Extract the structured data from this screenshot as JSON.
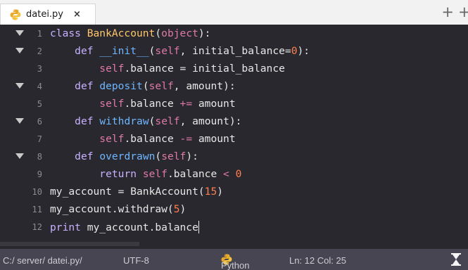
{
  "tab": {
    "filename": "datei.py",
    "close_label": "×"
  },
  "toolbar": {
    "add_icon": "+",
    "menu_icon": "+"
  },
  "editor": {
    "lines": [
      {
        "num": "1",
        "fold": true,
        "tokens": [
          [
            "k",
            "class "
          ],
          [
            "c",
            "BankAccount"
          ],
          [
            "o",
            "("
          ],
          [
            "s",
            "object"
          ],
          [
            "o",
            "):"
          ]
        ]
      },
      {
        "num": "2",
        "fold": true,
        "tokens": [
          [
            "o",
            "    "
          ],
          [
            "k",
            "def "
          ],
          [
            "f",
            "__init__"
          ],
          [
            "o",
            "("
          ],
          [
            "s",
            "self"
          ],
          [
            "o",
            ", initial_balance="
          ],
          [
            "n",
            "0"
          ],
          [
            "o",
            "):"
          ]
        ]
      },
      {
        "num": "3",
        "fold": false,
        "tokens": [
          [
            "o",
            "        "
          ],
          [
            "s",
            "self"
          ],
          [
            "o",
            ".balance = initial_balance"
          ]
        ]
      },
      {
        "num": "4",
        "fold": true,
        "tokens": [
          [
            "o",
            "    "
          ],
          [
            "k",
            "def "
          ],
          [
            "f",
            "deposit"
          ],
          [
            "o",
            "("
          ],
          [
            "s",
            "self"
          ],
          [
            "o",
            ", amount):"
          ]
        ]
      },
      {
        "num": "5",
        "fold": false,
        "tokens": [
          [
            "o",
            "        "
          ],
          [
            "s",
            "self"
          ],
          [
            "o",
            ".balance "
          ],
          [
            "s",
            "+="
          ],
          [
            "o",
            " amount"
          ]
        ]
      },
      {
        "num": "6",
        "fold": true,
        "tokens": [
          [
            "o",
            "    "
          ],
          [
            "k",
            "def "
          ],
          [
            "f",
            "withdraw"
          ],
          [
            "o",
            "("
          ],
          [
            "s",
            "self"
          ],
          [
            "o",
            ", amount):"
          ]
        ]
      },
      {
        "num": "7",
        "fold": false,
        "tokens": [
          [
            "o",
            "        "
          ],
          [
            "s",
            "self"
          ],
          [
            "o",
            ".balance "
          ],
          [
            "s",
            "-="
          ],
          [
            "o",
            " amount"
          ]
        ]
      },
      {
        "num": "8",
        "fold": true,
        "tokens": [
          [
            "o",
            "    "
          ],
          [
            "k",
            "def "
          ],
          [
            "f",
            "overdrawn"
          ],
          [
            "o",
            "("
          ],
          [
            "s",
            "self"
          ],
          [
            "o",
            "):"
          ]
        ]
      },
      {
        "num": "9",
        "fold": false,
        "tokens": [
          [
            "o",
            "        "
          ],
          [
            "k",
            "return "
          ],
          [
            "s",
            "self"
          ],
          [
            "o",
            ".balance "
          ],
          [
            "s",
            "<"
          ],
          [
            "o",
            " "
          ],
          [
            "n",
            "0"
          ]
        ]
      },
      {
        "num": "10",
        "fold": false,
        "tokens": [
          [
            "o",
            "my_account = BankAccount("
          ],
          [
            "n",
            "15"
          ],
          [
            "o",
            ")"
          ]
        ]
      },
      {
        "num": "11",
        "fold": false,
        "tokens": [
          [
            "o",
            "my_account.withdraw("
          ],
          [
            "n",
            "5"
          ],
          [
            "o",
            ")"
          ]
        ]
      },
      {
        "num": "12",
        "fold": false,
        "cursor": true,
        "tokens": [
          [
            "k",
            "print "
          ],
          [
            "o",
            "my_account.balance"
          ]
        ]
      }
    ]
  },
  "status": {
    "path": "C:/ server/ datei.py/",
    "encoding": "UTF-8",
    "language": "Python",
    "position": "Ln: 12 Col: 25"
  },
  "colors": {
    "editor_bg": "#29282e",
    "status_bg": "#474552",
    "keyword": "#c8b1ff",
    "class_name": "#ffc66d",
    "function_name": "#6eb6ff",
    "builtin": "#e07ba6",
    "number": "#ff7f50"
  }
}
